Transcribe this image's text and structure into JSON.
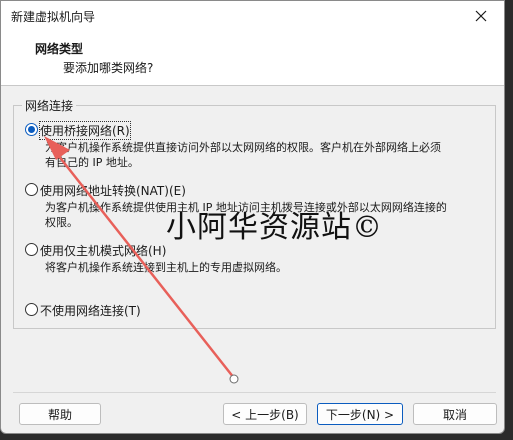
{
  "window": {
    "title": "新建虚拟机向导"
  },
  "header": {
    "title": "网络类型",
    "subtitle": "要添加哪类网络?"
  },
  "group": {
    "title": "网络连接"
  },
  "options": [
    {
      "label": "使用桥接网络(R)",
      "selected": true,
      "desc": [
        "为客户机操作系统提供直接访问外部以太网网络的权限。客户机在外部网络上必须",
        "有自己的 IP 地址。"
      ]
    },
    {
      "label": "使用网络地址转换(NAT)(E)",
      "selected": false,
      "desc": [
        "为客户机操作系统提供使用主机 IP 地址访问主机拨号连接或外部以太网网络连接的",
        "权限。"
      ]
    },
    {
      "label": "使用仅主机模式网络(H)",
      "selected": false,
      "desc": [
        "将客户机操作系统连接到主机上的专用虚拟网络。"
      ]
    },
    {
      "label": "不使用网络连接(T)",
      "selected": false,
      "desc": []
    }
  ],
  "buttons": {
    "help": "帮助",
    "back": "< 上一步(B)",
    "next": "下一步(N) >",
    "cancel": "取消"
  },
  "watermark": "小阿华资源站©",
  "colors": {
    "accent": "#0b5cbf",
    "arrow": "#e8605a"
  }
}
